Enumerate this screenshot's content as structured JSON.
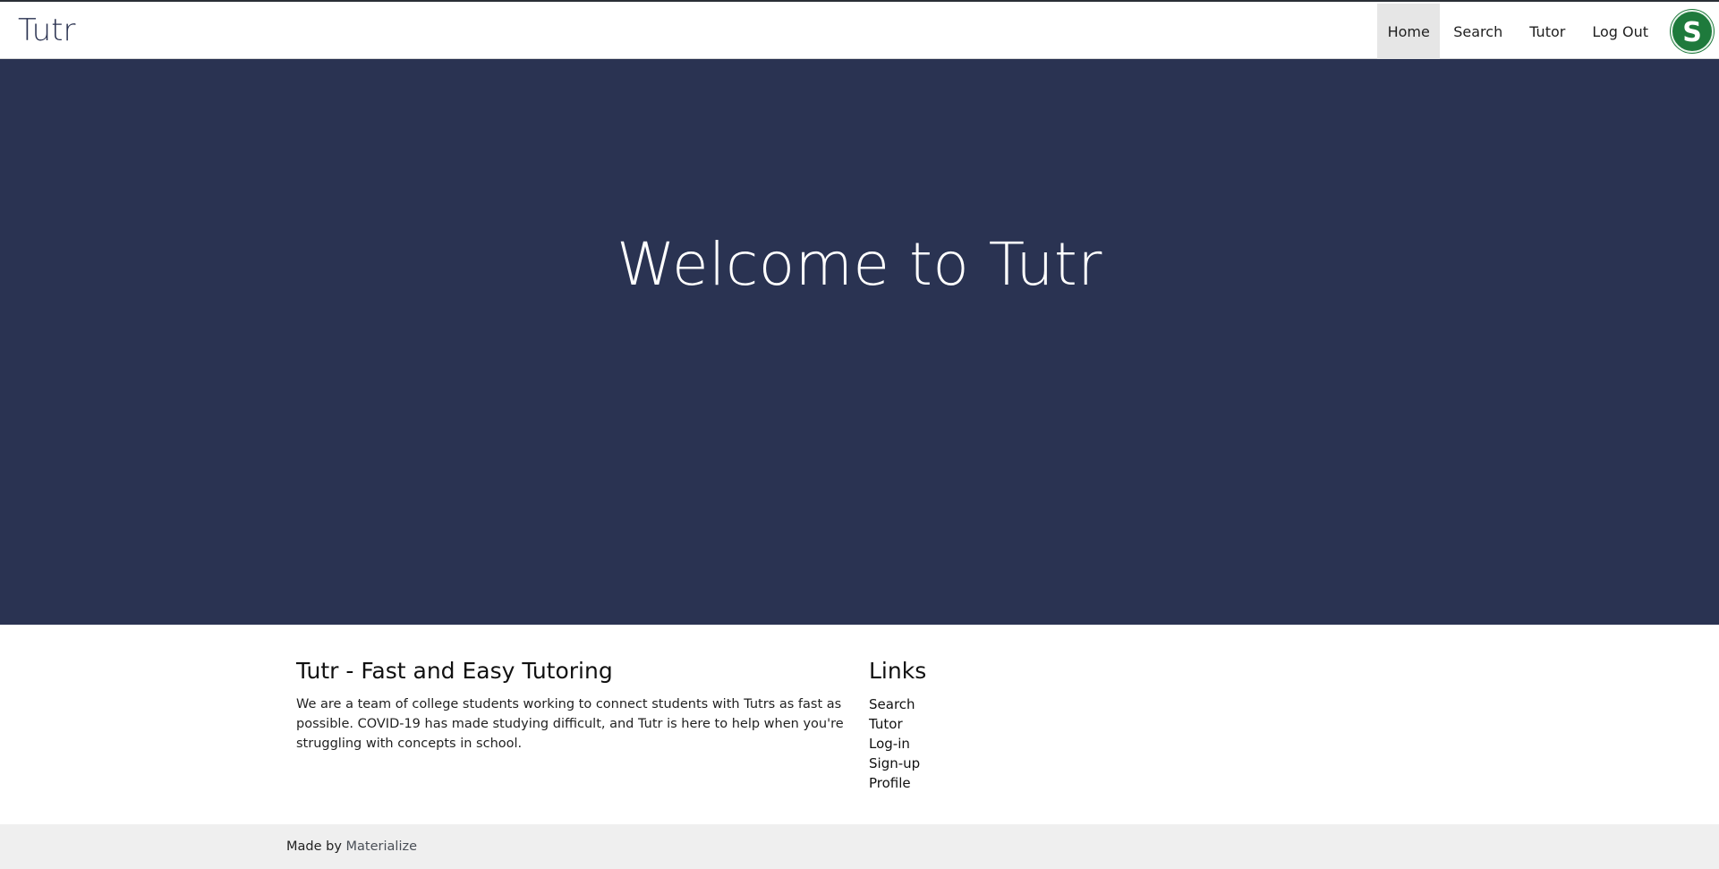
{
  "header": {
    "brand": "Tutr",
    "nav": [
      {
        "label": "Home",
        "active": true
      },
      {
        "label": "Search",
        "active": false
      },
      {
        "label": "Tutor",
        "active": false
      },
      {
        "label": "Log Out",
        "active": false
      }
    ],
    "avatar_icon": "green-s-logo-icon",
    "avatar_letter": "S",
    "avatar_color": "#1e7a3c"
  },
  "hero": {
    "title": "Welcome to Tutr",
    "background": "#2a3352"
  },
  "about": {
    "title": "Tutr - Fast and Easy Tutoring",
    "text": "We are a team of college students working to connect students with Tutrs as fast as possible. COVID-19 has made studying difficult, and Tutr is here to help when you're struggling with concepts in school."
  },
  "links": {
    "title": "Links",
    "items": [
      "Search",
      "Tutor",
      "Log-in",
      "Sign-up",
      "Profile"
    ]
  },
  "footer": {
    "prefix": "Made by ",
    "link": "Materialize"
  }
}
